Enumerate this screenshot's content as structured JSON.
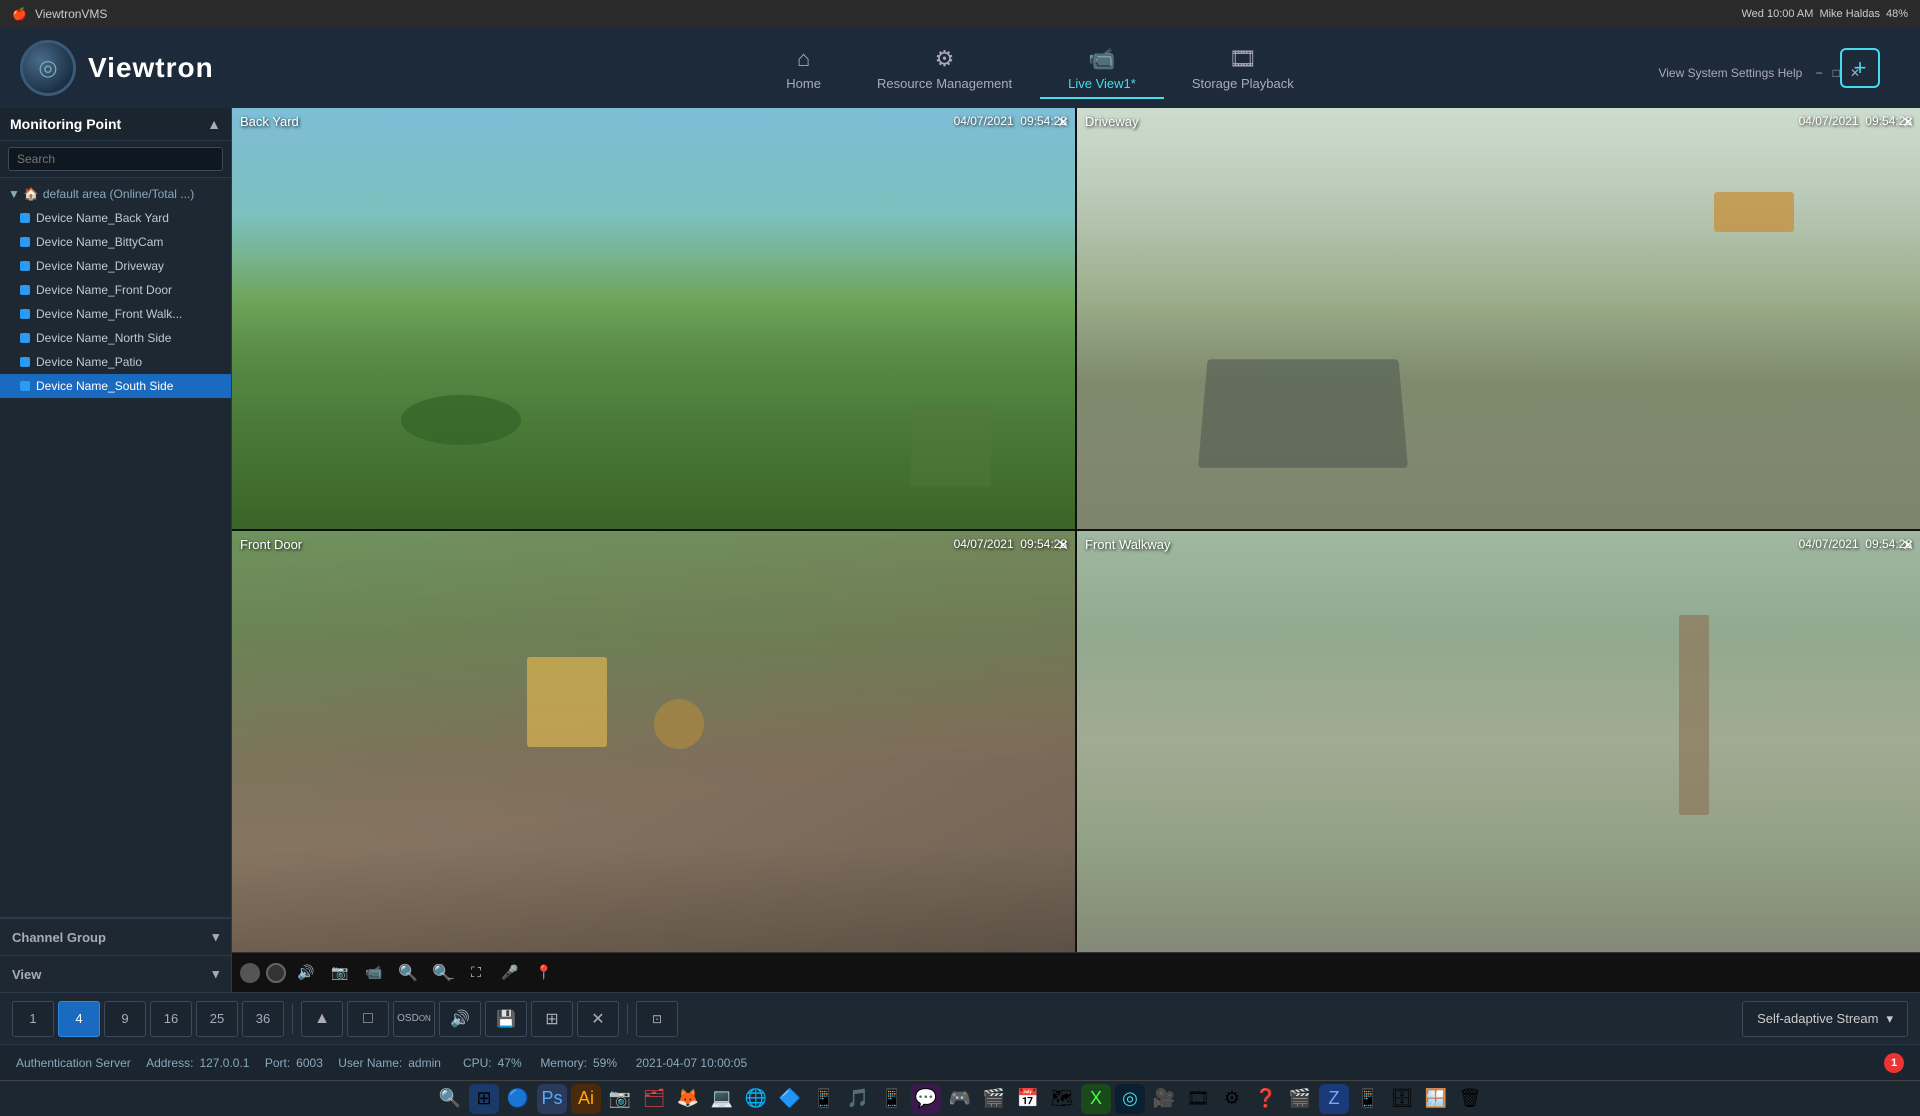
{
  "macbar": {
    "apple": "🍎",
    "app_name": "ViewtronVMS",
    "time": "Wed 10:00 AM",
    "user": "Mike Haldas",
    "battery": "48%",
    "wifi_icon": "wifi",
    "search_icon": "search",
    "close_icon": "✕"
  },
  "titlebar": {
    "logo_icon": "◎",
    "app_name": "Viewtron",
    "nav": [
      {
        "id": "home",
        "label": "Home",
        "icon": "⌂",
        "active": false
      },
      {
        "id": "resource",
        "label": "Resource Management",
        "icon": "⚙",
        "active": false
      },
      {
        "id": "live",
        "label": "Live View1*",
        "icon": "📹",
        "active": true
      },
      {
        "id": "playback",
        "label": "Storage Playback",
        "icon": "🎞",
        "active": false
      }
    ],
    "add_btn": "+",
    "help_text": "View System Settings Help",
    "window_min": "−",
    "window_max": "□",
    "window_close": "✕"
  },
  "sidebar": {
    "monitoring_title": "Monitoring Point",
    "collapse_icon": "▲",
    "search_placeholder": "Search",
    "tree": {
      "root_icon": "🏠",
      "root_toggle": "▼",
      "root_label": "default area (Online/Total ...)",
      "devices": [
        {
          "label": "Device Name_Back Yard",
          "selected": false
        },
        {
          "label": "Device Name_BittyCam",
          "selected": false
        },
        {
          "label": "Device Name_Driveway",
          "selected": false
        },
        {
          "label": "Device Name_Front Door",
          "selected": false
        },
        {
          "label": "Device Name_Front Walk...",
          "selected": false
        },
        {
          "label": "Device Name_North Side",
          "selected": false
        },
        {
          "label": "Device Name_Patio",
          "selected": false
        },
        {
          "label": "Device Name_South Side",
          "selected": true
        }
      ]
    },
    "channel_group": "Channel Group",
    "channel_expand": "▾",
    "view": "View",
    "view_expand": "▾"
  },
  "video": {
    "cells": [
      {
        "id": "backyard",
        "label": "Back Yard",
        "timestamp": "04/07/2021  09:54:28",
        "style": "backyard"
      },
      {
        "id": "driveway",
        "label": "Driveway",
        "timestamp": "04/07/2021  09:54:28",
        "style": "driveway"
      },
      {
        "id": "frontdoor",
        "label": "Front Door",
        "timestamp": "04/07/2021  09:54:28",
        "style": "frontdoor"
      },
      {
        "id": "walkway",
        "label": "Front Walkway",
        "timestamp": "04/07/2021  09:54:28",
        "style": "walkway"
      }
    ],
    "controls": [
      "▶",
      "●",
      "🔊",
      "📷",
      "📹",
      "🔍+",
      "🔍−",
      "⛶",
      "🎤",
      "📍"
    ]
  },
  "layout_bar": {
    "layouts": [
      "1",
      "4",
      "9",
      "16",
      "25",
      "36"
    ],
    "active_layout": "4",
    "icon_btns": [
      "▲",
      "□",
      "OSD",
      "🔊",
      "💾",
      "⊞",
      "✕"
    ],
    "grid_btn": "⊞",
    "stream_label": "Self-adaptive Stream",
    "stream_dropdown": "▾"
  },
  "statusbar": {
    "auth": "Authentication Server",
    "address_label": "Address:",
    "address": "127.0.0.1",
    "port_label": "Port:",
    "port": "6003",
    "user_label": "User Name:",
    "user": "admin",
    "cpu_label": "CPU:",
    "cpu": "47%",
    "mem_label": "Memory:",
    "mem": "59%",
    "datetime": "2021-04-07 10:00:05",
    "alert_count": "1"
  },
  "dock": {
    "icons": [
      "🔍",
      "📁",
      "📧",
      "🗒",
      "🔵",
      "🎨",
      "🦊",
      "📊",
      "📝",
      "🎵",
      "📷",
      "💬",
      "🔧",
      "🗃",
      "🖥"
    ]
  }
}
